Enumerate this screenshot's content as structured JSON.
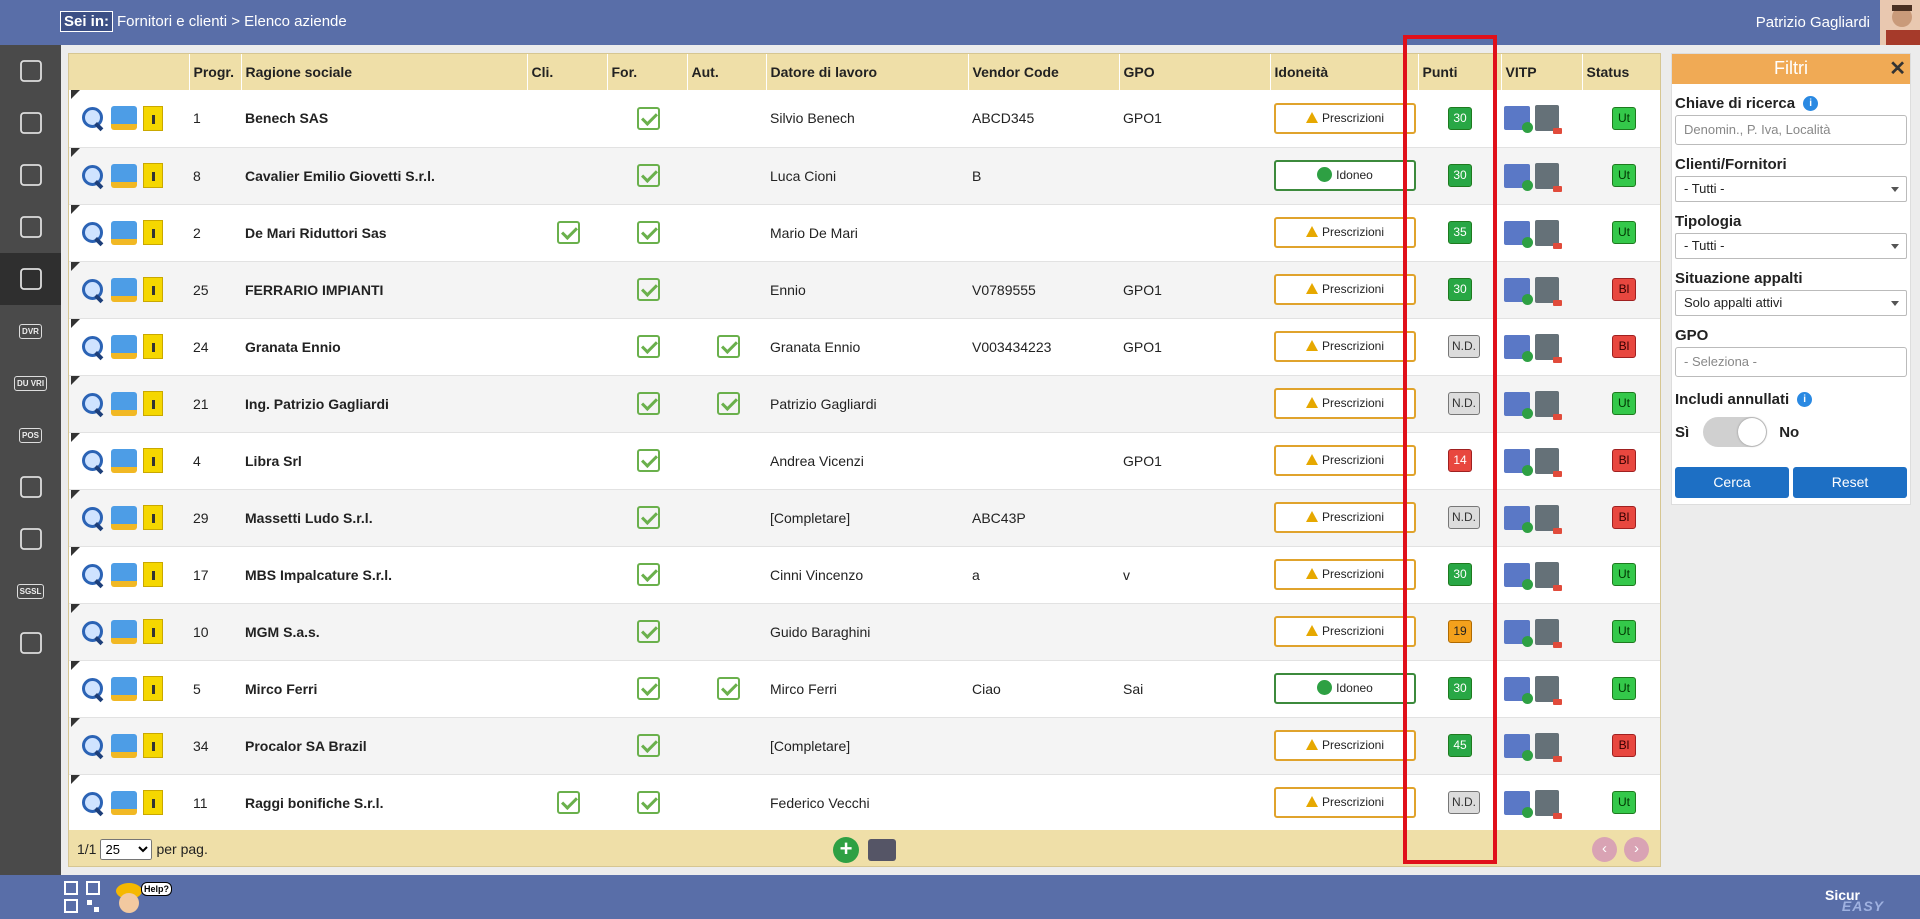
{
  "header": {
    "breadcrumb_label": "Sei in:",
    "breadcrumb_path": "Fornitori e clienti > Elenco aziende",
    "user_name": "Patrizio Gagliardi"
  },
  "sidebar": {
    "items": [
      {
        "icon": "puzzle-icon",
        "label": ""
      },
      {
        "icon": "document-icon",
        "label": ""
      },
      {
        "icon": "alert-icon",
        "label": ""
      },
      {
        "icon": "board-icon",
        "label": ""
      },
      {
        "icon": "chart-icon",
        "label": "",
        "active": true
      },
      {
        "icon": "dvr-icon",
        "label": "DVR"
      },
      {
        "icon": "duvri-icon",
        "label": "DU VRI"
      },
      {
        "icon": "pos-icon",
        "label": "POS"
      },
      {
        "icon": "info-icon",
        "label": ""
      },
      {
        "icon": "folder-icon",
        "label": ""
      },
      {
        "icon": "sgsl-icon",
        "label": "SGSL"
      },
      {
        "icon": "worker-icon",
        "label": ""
      }
    ]
  },
  "table": {
    "columns": [
      "",
      "Progr.",
      "Ragione sociale",
      "Cli.",
      "For.",
      "Aut.",
      "Datore di lavoro",
      "Vendor Code",
      "GPO",
      "Idoneità",
      "Punti",
      "VITP",
      "Status"
    ],
    "rows": [
      {
        "progr": "1",
        "ragione": "Benech SAS",
        "cli": false,
        "for": true,
        "aut": false,
        "datore": "Silvio Benech",
        "vendor": "ABCD345",
        "gpo": "GPO1",
        "idoneita": "Prescrizioni",
        "idoneo": false,
        "punti": "30",
        "punti_color": "green",
        "status": "Ut"
      },
      {
        "progr": "8",
        "ragione": "Cavalier Emilio Giovetti S.r.l.",
        "cli": false,
        "for": true,
        "aut": false,
        "datore": "Luca Cioni",
        "vendor": "B",
        "gpo": "",
        "idoneita": "Idoneo",
        "idoneo": true,
        "punti": "30",
        "punti_color": "green",
        "status": "Ut"
      },
      {
        "progr": "2",
        "ragione": "De Mari Riduttori Sas",
        "cli": true,
        "for": true,
        "aut": false,
        "datore": "Mario De Mari",
        "vendor": "",
        "gpo": "",
        "idoneita": "Prescrizioni",
        "idoneo": false,
        "punti": "35",
        "punti_color": "green",
        "status": "Ut"
      },
      {
        "progr": "25",
        "ragione": "FERRARIO IMPIANTI",
        "cli": false,
        "for": true,
        "aut": false,
        "datore": "Ennio",
        "vendor": "V0789555",
        "gpo": "GPO1",
        "idoneita": "Prescrizioni",
        "idoneo": false,
        "punti": "30",
        "punti_color": "green",
        "status": "Bl"
      },
      {
        "progr": "24",
        "ragione": "Granata Ennio",
        "cli": false,
        "for": true,
        "aut": true,
        "datore": "Granata Ennio",
        "vendor": "V003434223",
        "gpo": "GPO1",
        "idoneita": "Prescrizioni",
        "idoneo": false,
        "punti": "N.D.",
        "punti_color": "nd",
        "status": "Bl"
      },
      {
        "progr": "21",
        "ragione": "Ing. Patrizio Gagliardi",
        "cli": false,
        "for": true,
        "aut": true,
        "datore": "Patrizio Gagliardi",
        "vendor": "",
        "gpo": "",
        "idoneita": "Prescrizioni",
        "idoneo": false,
        "punti": "N.D.",
        "punti_color": "nd",
        "status": "Ut"
      },
      {
        "progr": "4",
        "ragione": "Libra Srl",
        "cli": false,
        "for": true,
        "aut": false,
        "datore": "Andrea Vicenzi",
        "vendor": "",
        "gpo": "GPO1",
        "idoneita": "Prescrizioni",
        "idoneo": false,
        "punti": "14",
        "punti_color": "red",
        "status": "Bl"
      },
      {
        "progr": "29",
        "ragione": "Massetti Ludo S.r.l.",
        "cli": false,
        "for": true,
        "aut": false,
        "datore": "[Completare]",
        "vendor": "ABC43P",
        "gpo": "",
        "idoneita": "Prescrizioni",
        "idoneo": false,
        "punti": "N.D.",
        "punti_color": "nd",
        "status": "Bl"
      },
      {
        "progr": "17",
        "ragione": "MBS Impalcature S.r.l.",
        "cli": false,
        "for": true,
        "aut": false,
        "datore": "Cinni Vincenzo",
        "vendor": "a",
        "gpo": "v",
        "idoneita": "Prescrizioni",
        "idoneo": false,
        "punti": "30",
        "punti_color": "green",
        "status": "Ut"
      },
      {
        "progr": "10",
        "ragione": "MGM S.a.s.",
        "cli": false,
        "for": true,
        "aut": false,
        "datore": "Guido Baraghini",
        "vendor": "",
        "gpo": "",
        "idoneita": "Prescrizioni",
        "idoneo": false,
        "punti": "19",
        "punti_color": "orange",
        "status": "Ut"
      },
      {
        "progr": "5",
        "ragione": "Mirco Ferri",
        "cli": false,
        "for": true,
        "aut": true,
        "datore": "Mirco Ferri",
        "vendor": "Ciao",
        "gpo": "Sai",
        "idoneita": "Idoneo",
        "idoneo": true,
        "punti": "30",
        "punti_color": "green",
        "status": "Ut"
      },
      {
        "progr": "34",
        "ragione": "Procalor SA Brazil",
        "cli": false,
        "for": true,
        "aut": false,
        "datore": "[Completare]",
        "vendor": "",
        "gpo": "",
        "idoneita": "Prescrizioni",
        "idoneo": false,
        "punti": "45",
        "punti_color": "green",
        "status": "Bl"
      },
      {
        "progr": "11",
        "ragione": "Raggi bonifiche S.r.l.",
        "cli": true,
        "for": true,
        "aut": false,
        "datore": "Federico Vecchi",
        "vendor": "",
        "gpo": "",
        "idoneita": "Prescrizioni",
        "idoneo": false,
        "punti": "N.D.",
        "punti_color": "nd",
        "status": "Ut"
      }
    ]
  },
  "footer": {
    "page": "1/1",
    "per_page_value": "25",
    "per_page_label": "per pag."
  },
  "filters": {
    "title": "Filtri",
    "search_label": "Chiave di ricerca",
    "search_placeholder": "Denomin., P. Iva, Località",
    "clienti_label": "Clienti/Fornitori",
    "clienti_value": "- Tutti -",
    "tipologia_label": "Tipologia",
    "tipologia_value": "- Tutti -",
    "appalti_label": "Situazione appalti",
    "appalti_value": "Solo appalti attivi",
    "gpo_label": "GPO",
    "gpo_placeholder": "- Seleziona -",
    "annullati_label": "Includi annullati",
    "si_label": "Sì",
    "no_label": "No",
    "search_button": "Cerca",
    "reset_button": "Reset"
  },
  "bottom": {
    "help_label": "Help?",
    "brand_top": "Sicur",
    "brand_bottom": "EASY"
  }
}
